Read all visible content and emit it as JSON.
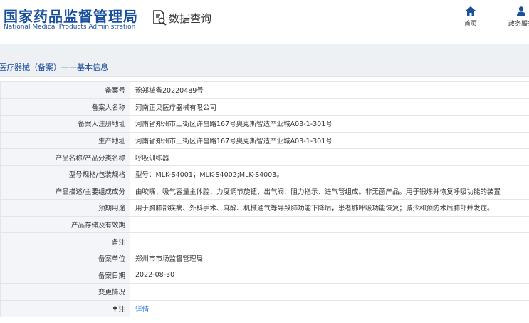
{
  "header": {
    "logo_cn": "国家药品监督管理局",
    "logo_en": "National Medical Products Administration",
    "query_label": "数据查询",
    "nav": [
      {
        "label": "首页",
        "icon": "home-icon"
      },
      {
        "label": "政务服务",
        "icon": "user-icon"
      }
    ]
  },
  "section": {
    "title": "医疗器械（备案）——基本信息"
  },
  "rows": [
    {
      "label": "备案号",
      "value": "豫郑械备20220489号"
    },
    {
      "label": "备案人名称",
      "value": "河南正贝医疗器械有限公司"
    },
    {
      "label": "备案人注册地址",
      "value": "河南省郑州市上街区许昌路167号奥克斯智造产业城A03-1-301号"
    },
    {
      "label": "生产地址",
      "value": "河南省郑州市上街区许昌路167号奥克斯智造产业城A03-1-301号"
    },
    {
      "label": "产品名称/产品分类名称",
      "value": "呼吸训练器"
    },
    {
      "label": "型号规格/包装规格",
      "value": "型号：MLK-S4001；MLK-S4002;MLK-S4003。"
    },
    {
      "label": "产品描述/主要组成成分",
      "value": "由咬嘴、吸气容量主体腔、力度调节旋钮、出气阀、阻力指示、进气管组成。非无菌产品。用于锻炼并恢复呼吸功能的装置"
    },
    {
      "label": "预期用途",
      "value": "用于胸肺部疾病、外科手术、麻醉、机械通气等导致肺功能下降后，患者肺呼吸功能恢复；减少和预防术后肺部并发症。"
    },
    {
      "label": "产品存储及有效期",
      "value": ""
    },
    {
      "label": "备注",
      "value": ""
    },
    {
      "label": "备案单位",
      "value": "郑州市市场监督管理局"
    },
    {
      "label": "备案日期",
      "value": "2022-08-30"
    },
    {
      "label": "变更情况",
      "value": ""
    },
    {
      "label": "注",
      "value": "详情",
      "icon": "pin-icon"
    }
  ],
  "colors": {
    "brand_blue": "#1a4f9c",
    "link_blue": "#1a6fd1",
    "label_bg": "#f3f5f8",
    "border": "#e2e6eb"
  }
}
